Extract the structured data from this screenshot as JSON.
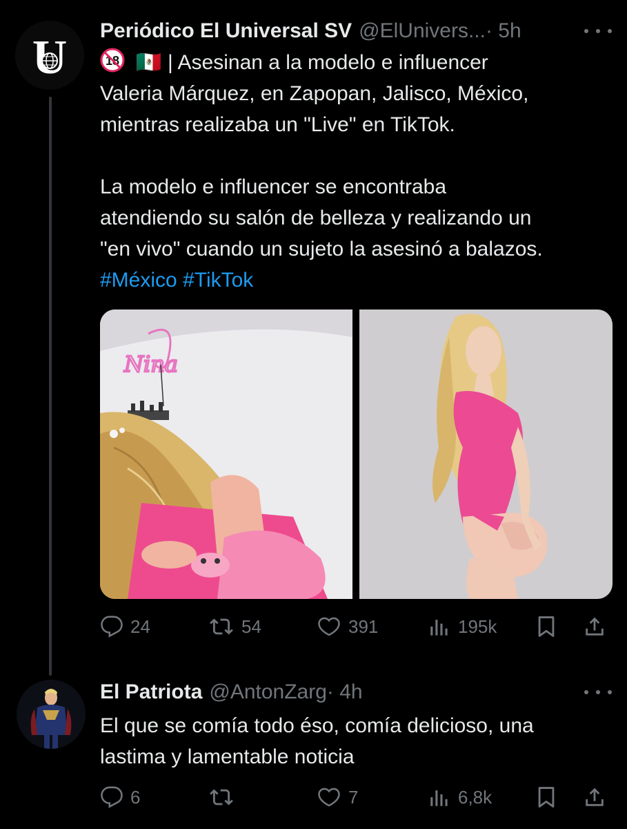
{
  "tweet": {
    "author_name": "Periódico El Universal SV",
    "author_handle": "@ElUnivers...",
    "time": " · 5h",
    "avatar_letter": "U",
    "flag_emoji": "🇲🇽",
    "text_line1": " | Asesinan a la modelo e influencer",
    "text_line2": "Valeria Márquez, en Zapopan, Jalisco, México,",
    "text_line3": "mientras realizaba un \"Live\" en TikTok.",
    "text_line4": "La modelo e influencer se encontraba",
    "text_line5": "atendiendo su salón de belleza y realizando un",
    "text_line6": "\"en vivo\" cuando un sujeto la asesinó a balazos.",
    "hashtag1": "#México",
    "hashtag2": "#TikTok",
    "age_badge": "18",
    "media_left_neon": "Nina",
    "stats": {
      "replies": "24",
      "reposts": "54",
      "likes": "391",
      "views": "195k"
    }
  },
  "reply": {
    "author_name": "El Patriota",
    "author_handle": "@AntonZarg",
    "time": " · 4h",
    "text_line1": "El que se comía todo éso, comía delicioso, una",
    "text_line2": "lastima y lamentable noticia",
    "stats": {
      "replies": "6",
      "reposts": "",
      "likes": "7",
      "views": "6,8k"
    }
  },
  "colors": {
    "background": "#000000",
    "text": "#e7e9ea",
    "muted": "#71767b",
    "link": "#1d9bf0",
    "thread_line": "#333639"
  }
}
